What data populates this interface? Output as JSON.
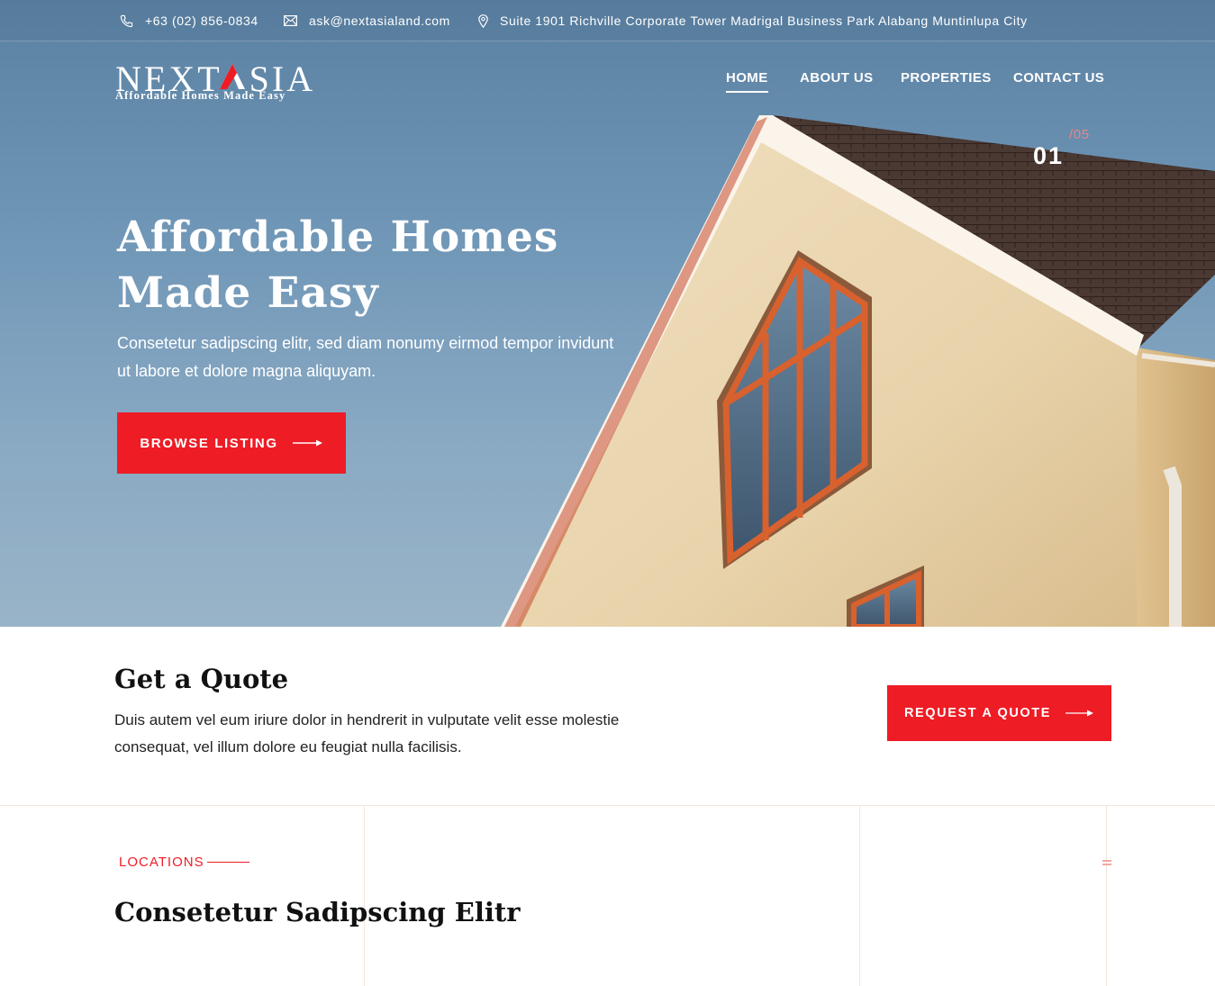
{
  "topbar": {
    "phone": "+63 (02) 856-0834",
    "email": "ask@nextasialand.com",
    "address": "Suite 1901 Richville Corporate Tower Madrigal Business Park Alabang Muntinlupa City",
    "icons": [
      "phone-icon",
      "mail-icon",
      "location-pin-icon"
    ]
  },
  "logo": {
    "left_text": "NEXT",
    "right_text": "SIA",
    "tagline": "Affordable Homes Made Easy"
  },
  "nav": {
    "items": [
      {
        "label": "HOME",
        "active": true
      },
      {
        "label": "ABOUT US",
        "active": false
      },
      {
        "label": "PROPERTIES",
        "active": false
      },
      {
        "label": "CONTACT US",
        "active": false
      }
    ]
  },
  "slider": {
    "current": "01",
    "total": "/05"
  },
  "hero": {
    "title": "Affordable Homes Made Easy",
    "subtitle": "Consetetur sadipscing elitr, sed diam nonumy eirmod tempor invidunt ut labore et dolore magna aliquyam.",
    "button_label": "BROWSE LISTING"
  },
  "quote": {
    "title": "Get a Quote",
    "text": "Duis autem vel eum iriure dolor in hendrerit in vulputate velit esse molestie consequat, vel illum dolore eu feugiat nulla facilisis.",
    "button_label": "REQUEST A QUOTE"
  },
  "locations": {
    "label": "LOCATIONS",
    "title": "Consetetur Sadipscing Elitr"
  },
  "colors": {
    "accent": "#ee1c25",
    "sky": "#6f94b3",
    "wall": "#e9d6b0",
    "roof": "#4e3b34",
    "window_frame": "#c8552a"
  }
}
